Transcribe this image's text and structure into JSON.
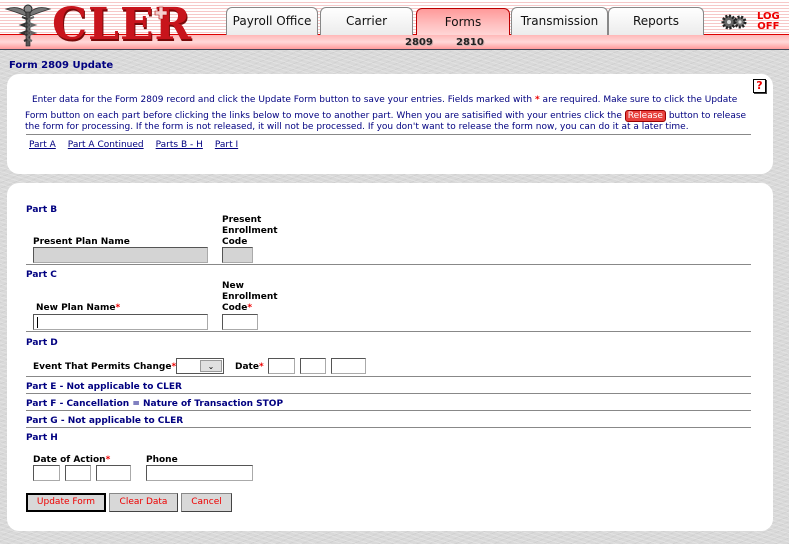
{
  "header": {
    "logo_text": "CLER",
    "tabs": [
      {
        "label": "Payroll Office",
        "active": false
      },
      {
        "label": "Carrier",
        "active": false
      },
      {
        "label": "Forms",
        "active": true
      },
      {
        "label": "Transmission",
        "active": false
      },
      {
        "label": "Reports",
        "active": false
      }
    ],
    "subtabs": [
      "2809",
      "2810"
    ],
    "logoff_line1": "LOG",
    "logoff_line2": "OFF",
    "accent_color": "#c8141c"
  },
  "page": {
    "title": "Form 2809 Update",
    "help_icon": "?",
    "intro": {
      "line1_a": "Enter data for the Form 2809 record and click the Update Form button to save your entries.  Fields marked with ",
      "required_mark": "*",
      "line1_b": " are required.  Make sure to click the Update",
      "line2_a": "Form button on each part before clicking the links below to move to another part.  When you are satisified with your entries click the ",
      "release_label": "Release",
      "line2_b": " button to release",
      "line3": "the form for processing.  If the form is not released, it will not be processed.  If you don't want to release the form now, you can do it at a later time."
    },
    "links": [
      "Part A",
      "Part A Continued",
      "Parts B - H",
      "Part I"
    ]
  },
  "form": {
    "part_b": {
      "heading": "Part B",
      "present_plan_name_label": "Present Plan Name",
      "present_enrollment_code_label_1": "Present",
      "present_enrollment_code_label_2": "Enrollment",
      "present_enrollment_code_label_3": "Code",
      "present_plan_name_value": "",
      "present_enrollment_code_value": ""
    },
    "part_c": {
      "heading": "Part C",
      "new_plan_name_label": "New Plan Name",
      "new_enrollment_code_label_1": "New",
      "new_enrollment_code_label_2": "Enrollment",
      "new_enrollment_code_label_3": "Code",
      "new_plan_name_value": "",
      "new_enrollment_code_value": ""
    },
    "part_d": {
      "heading": "Part D",
      "event_label": "Event That Permits Change",
      "event_selected": "",
      "date_label": "Date",
      "date_month": "",
      "date_day": "",
      "date_year": ""
    },
    "part_e": "Part E - Not applicable to CLER",
    "part_f": "Part F - Cancellation = Nature of Transaction STOP",
    "part_g": "Part G - Not applicable to CLER",
    "part_h": {
      "heading": "Part H",
      "date_of_action_label": "Date of Action",
      "phone_label": "Phone",
      "date_month": "",
      "date_day": "",
      "date_year": "",
      "phone_value": ""
    },
    "required_mark": "*",
    "buttons": {
      "update": "Update Form",
      "clear": "Clear Data",
      "cancel": "Cancel"
    }
  }
}
